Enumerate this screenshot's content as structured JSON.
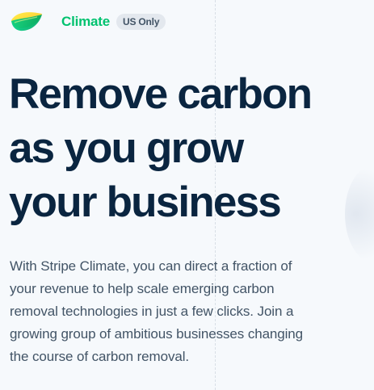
{
  "header": {
    "logo_icon": "stripe-climate-logo-icon",
    "brand_name": "Climate",
    "badge": "US Only"
  },
  "hero": {
    "title_lines": [
      "Remove carbon",
      "as you grow",
      "your business"
    ],
    "body_lines": [
      "With Stripe Climate, you can direct a fraction of",
      "your revenue to help scale emerging carbon",
      "removal technologies in just a few clicks. Join a",
      "growing group of ambitious businesses changing",
      "the course of carbon removal."
    ]
  },
  "colors": {
    "brand_green": "#00c26f",
    "logo_yellow": "#ffd43b",
    "heading_navy": "#0a2540",
    "body_slate": "#425466",
    "badge_bg": "#e3e8ee",
    "page_bg": "#f6f9fc"
  }
}
